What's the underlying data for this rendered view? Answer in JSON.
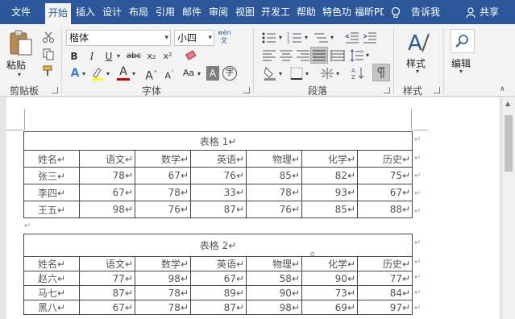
{
  "tabs": [
    "文件",
    "开始",
    "插入",
    "设计",
    "布局",
    "引用",
    "邮件",
    "审阅",
    "视图",
    "开发工",
    "帮助",
    "特色功",
    "福昕PD"
  ],
  "active_tab": "开始",
  "tell_me": "告诉我",
  "share": "共享",
  "ribbon": {
    "paste_label": "粘贴",
    "clipboard_label": "剪贴板",
    "font_name": "楷体",
    "font_size": "小四",
    "wen_icon": "wén\n文",
    "font_label": "字体",
    "paragraph_label": "段落",
    "styles_btn": "样式",
    "styles_label": "样式",
    "edit_btn": "编辑",
    "bold": "B",
    "italic": "I",
    "underline": "U",
    "strike": "abc",
    "sub": "x₂",
    "sup": "x²",
    "font_a": "A",
    "grow_a": "A",
    "shrink_a": "A",
    "aa": "Aa",
    "char_a": "A",
    "circle_char": "字"
  },
  "paragraph_mark": "↵",
  "table1": {
    "title": "表格 1↵",
    "headers": [
      "姓名↵",
      "语文↵",
      "数学↵",
      "英语↵",
      "物理↵",
      "化学↵",
      "历史↵"
    ],
    "rows": [
      [
        "张三↵",
        "78↵",
        "67↵",
        "76↵",
        "85↵",
        "82↵",
        "75↵"
      ],
      [
        "李四↵",
        "67↵",
        "78↵",
        "33↵",
        "78↵",
        "93↵",
        "67↵"
      ],
      [
        "王五↵",
        "98↵",
        "76↵",
        "87↵",
        "76↵",
        "85↵",
        "88↵"
      ]
    ]
  },
  "table2": {
    "title": "表格 2↵",
    "headers": [
      "姓名↵",
      "语文↵",
      "数学↵",
      "英语↵",
      "物理↵",
      "化学↵",
      "历史↵"
    ],
    "rows": [
      [
        "赵六↵",
        "77↵",
        "98↵",
        "67↵",
        "58↵",
        "90↵",
        "77↵"
      ],
      [
        "马七↵",
        "87↵",
        "78↵",
        "89↵",
        "90↵",
        "73↵",
        "84↵"
      ],
      [
        "黑八↵",
        "67↵",
        "78↵",
        "87↵",
        "98↵",
        "69↵",
        "97↵"
      ]
    ]
  }
}
